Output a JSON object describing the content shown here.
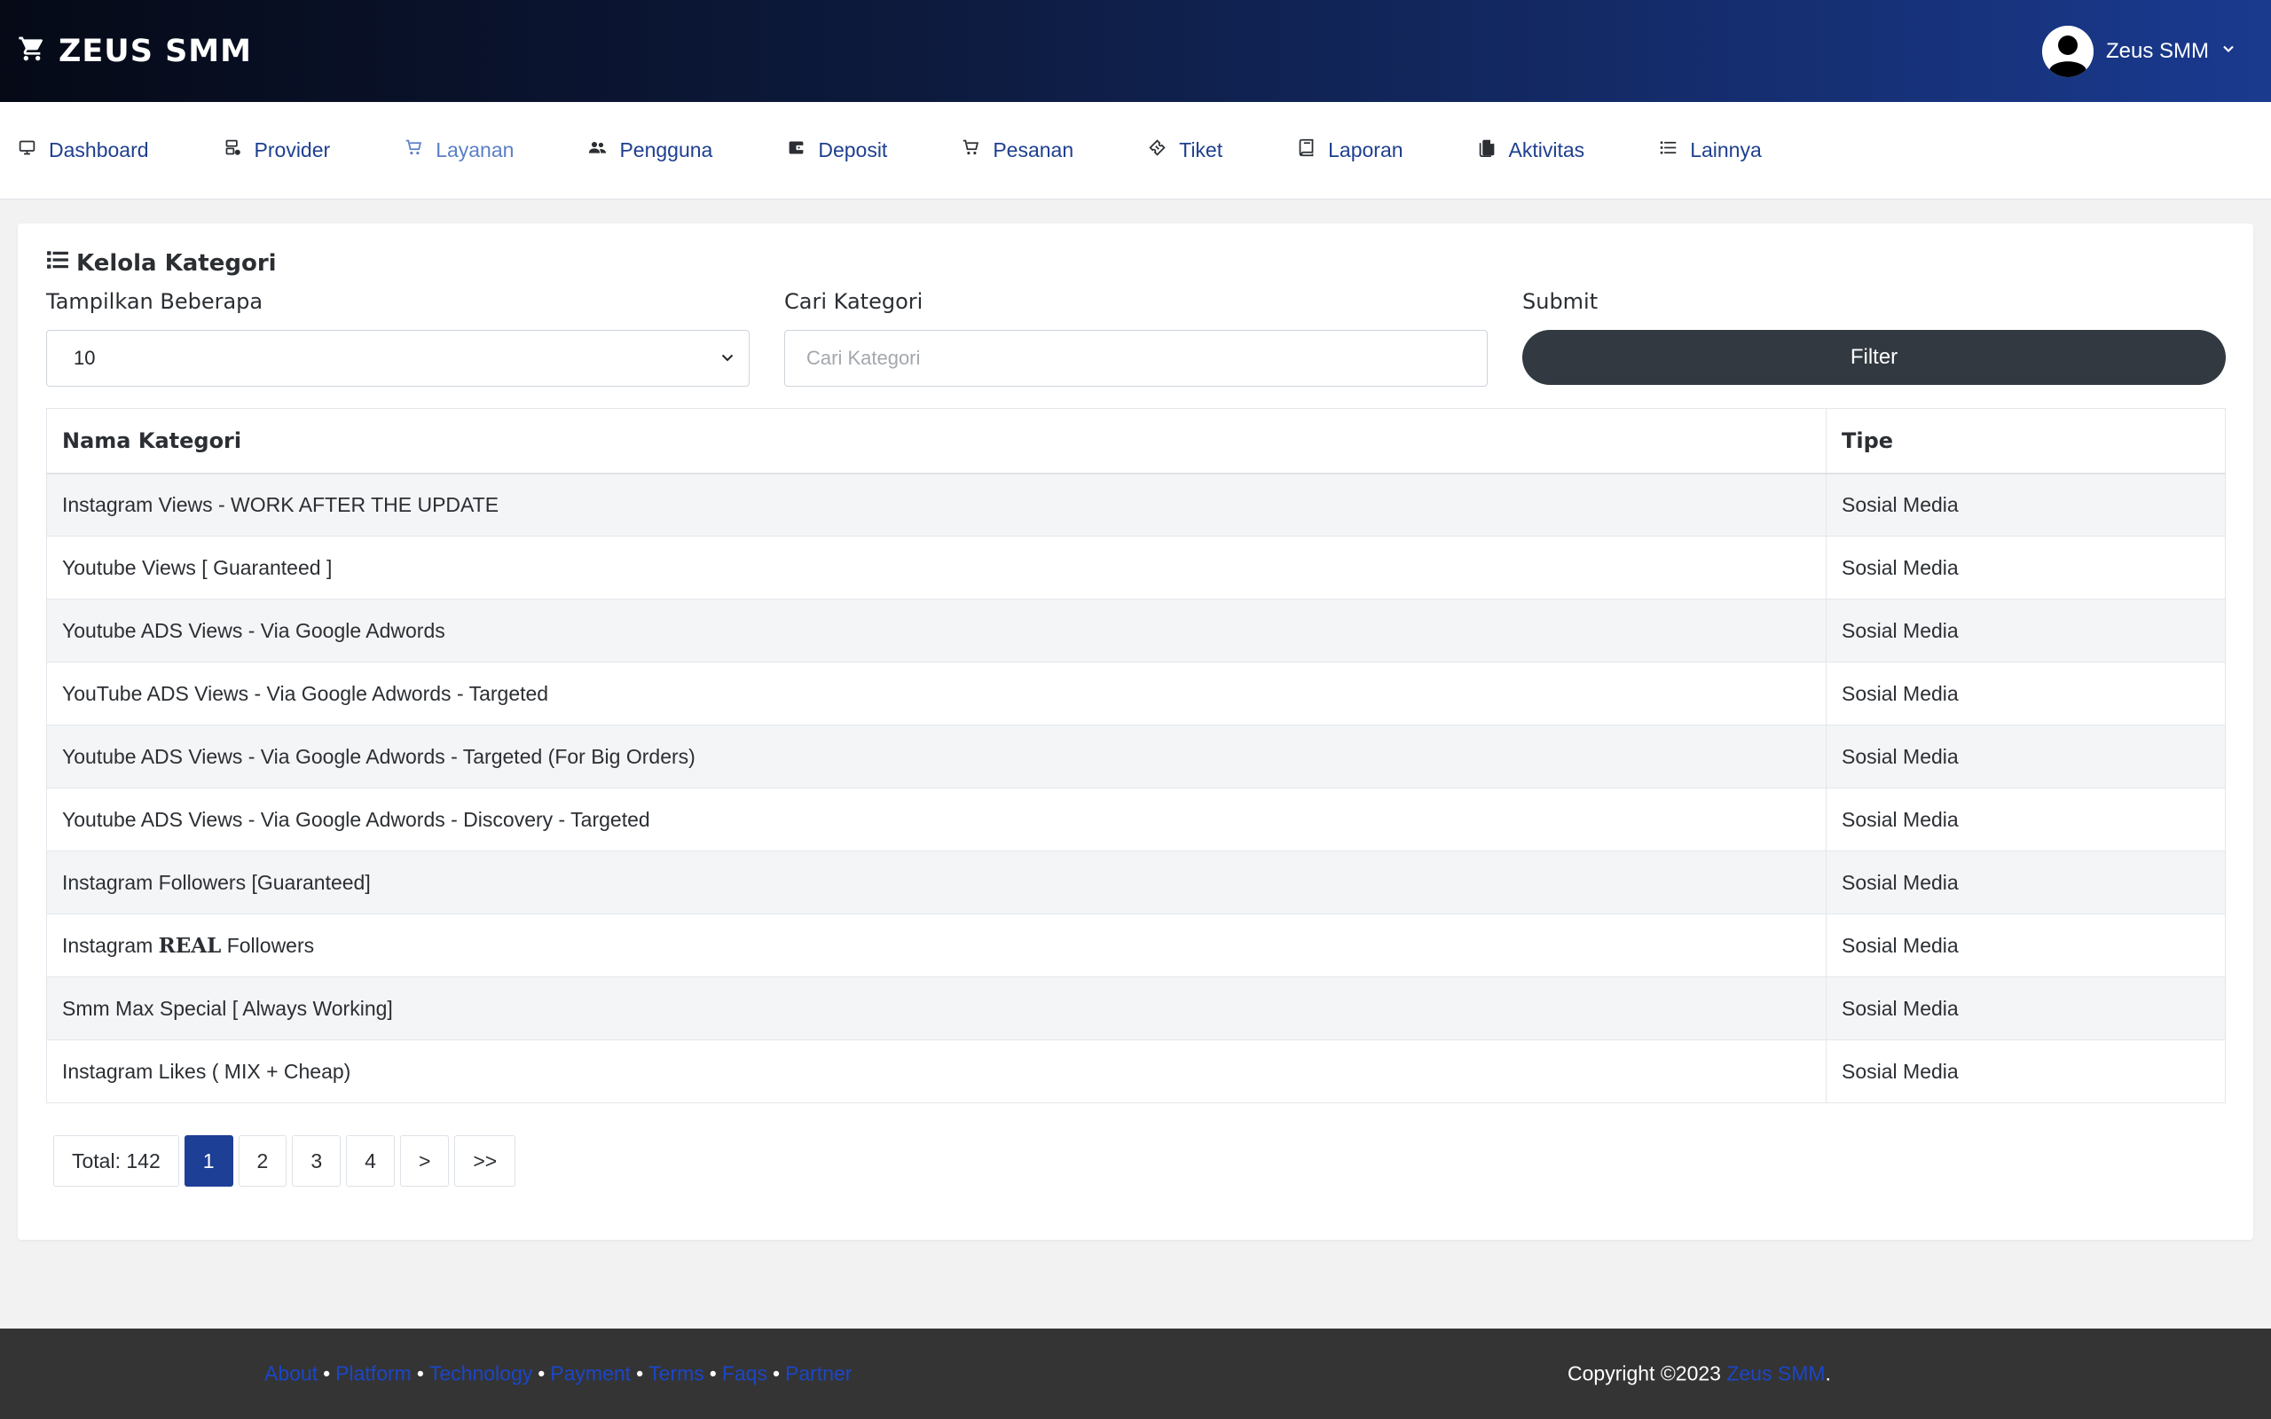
{
  "header": {
    "brand": "ZEUS SMM",
    "brand_icon": "cart-icon",
    "user_name": "Zeus SMM"
  },
  "nav": {
    "items": [
      {
        "label": "Dashboard",
        "icon": "monitor-icon"
      },
      {
        "label": "Provider",
        "icon": "server-icon"
      },
      {
        "label": "Layanan",
        "icon": "cart-icon",
        "active": true
      },
      {
        "label": "Pengguna",
        "icon": "users-icon"
      },
      {
        "label": "Deposit",
        "icon": "wallet-icon"
      },
      {
        "label": "Pesanan",
        "icon": "cart-icon"
      },
      {
        "label": "Tiket",
        "icon": "ticket-icon"
      },
      {
        "label": "Laporan",
        "icon": "book-icon"
      },
      {
        "label": "Aktivitas",
        "icon": "file-icon"
      },
      {
        "label": "Lainnya",
        "icon": "list-icon"
      }
    ]
  },
  "card": {
    "title": "Kelola Kategori",
    "show_label": "Tampilkan Beberapa",
    "show_value": "10",
    "search_label": "Cari Kategori",
    "search_placeholder": "Cari Kategori",
    "search_value": "",
    "submit_label": "Submit",
    "filter_button": "Filter"
  },
  "table": {
    "columns": [
      "Nama Kategori",
      "Tipe"
    ],
    "rows": [
      {
        "name_parts": [
          {
            "text": "Instagram Views - WORK AFTER THE UPDATE"
          }
        ],
        "type": "Sosial Media"
      },
      {
        "name_parts": [
          {
            "text": "Youtube Views [ Guaranteed ]"
          }
        ],
        "type": "Sosial Media"
      },
      {
        "name_parts": [
          {
            "text": "Youtube ADS Views - Via Google Adwords"
          }
        ],
        "type": "Sosial Media"
      },
      {
        "name_parts": [
          {
            "text": "YouTube ADS Views - Via Google Adwords - Targeted"
          }
        ],
        "type": "Sosial Media"
      },
      {
        "name_parts": [
          {
            "text": "Youtube ADS Views - Via Google Adwords - Targeted (For Big Orders)"
          }
        ],
        "type": "Sosial Media"
      },
      {
        "name_parts": [
          {
            "text": "Youtube ADS Views - Via Google Adwords - Discovery - Targeted"
          }
        ],
        "type": "Sosial Media"
      },
      {
        "name_parts": [
          {
            "text": "Instagram Followers [Guaranteed]"
          }
        ],
        "type": "Sosial Media"
      },
      {
        "name_parts": [
          {
            "text": "Instagram "
          },
          {
            "text": "REAL",
            "bold": true
          },
          {
            "text": " Followers"
          }
        ],
        "type": "Sosial Media"
      },
      {
        "name_parts": [
          {
            "text": "Smm Max Special [ Always Working]"
          }
        ],
        "type": "Sosial Media"
      },
      {
        "name_parts": [
          {
            "text": "Instagram Likes ( MIX + Cheap)"
          }
        ],
        "type": "Sosial Media"
      }
    ]
  },
  "pagination": {
    "total": "Total: 142",
    "pages": [
      "1",
      "2",
      "3",
      "4",
      ">",
      ">>"
    ],
    "current": "1"
  },
  "footer": {
    "links": [
      "About",
      "Platform",
      "Technology",
      "Payment",
      "Terms",
      "Faqs",
      "Partner"
    ],
    "separator": "•",
    "copyright_prefix": "Copyright ©2023 ",
    "copyright_brand": "Zeus SMM",
    "copyright_suffix": "."
  }
}
